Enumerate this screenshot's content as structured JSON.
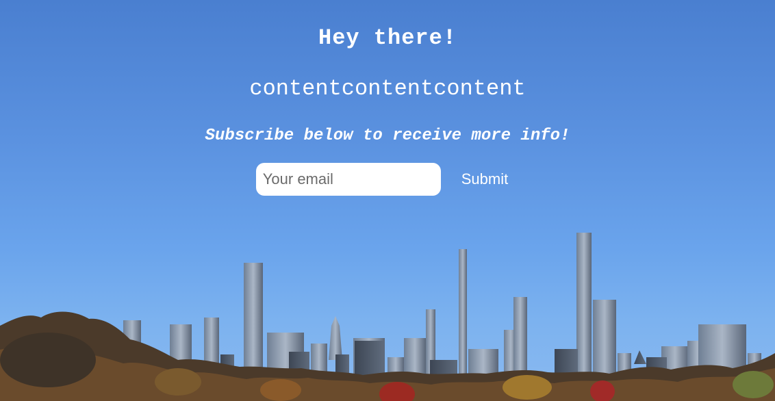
{
  "heading": "Hey there!",
  "body_text": "contentcontentcontent",
  "subtitle": "Subscribe below to receive more info!",
  "form": {
    "email_placeholder": "Your email",
    "submit_label": "Submit"
  },
  "colors": {
    "sky_top": "#4a7fd0",
    "sky_bottom": "#8bbaf0",
    "text": "#ffffff"
  }
}
